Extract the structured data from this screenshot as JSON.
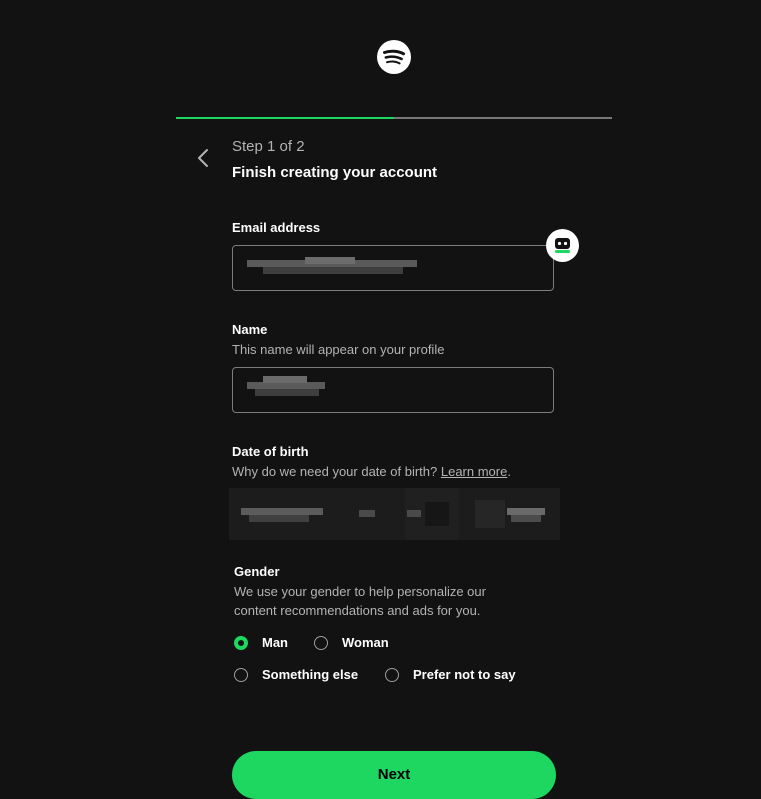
{
  "colors": {
    "background": "#121212",
    "accent": "#1ed760",
    "muted_text": "#b3b3b3",
    "border": "#7c7c7c"
  },
  "icons": {
    "logo": "spotify-logo-icon",
    "back": "chevron-left-icon",
    "password_helper": "helper-robot-icon"
  },
  "progress": {
    "fraction": 0.5
  },
  "header": {
    "step": "Step 1 of 2",
    "title": "Finish creating your account"
  },
  "email": {
    "label": "Email address"
  },
  "name": {
    "label": "Name",
    "hint": "This name will appear on your profile"
  },
  "dob": {
    "label": "Date of birth",
    "hint_prefix": "Why do we need your date of birth?",
    "link": "Learn more",
    "hint_suffix": "."
  },
  "gender": {
    "label": "Gender",
    "hint_line1": "We use your gender to help personalize our",
    "hint_line2": "content recommendations and ads for you.",
    "options": [
      "Man",
      "Woman",
      "Something else",
      "Prefer not to say"
    ],
    "selected": "Man"
  },
  "next_button": "Next"
}
